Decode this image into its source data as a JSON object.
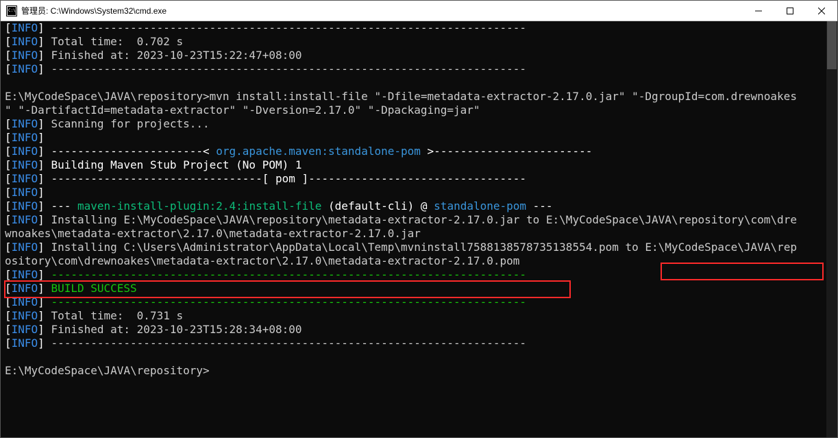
{
  "window": {
    "title": "管理员: C:\\Windows\\System32\\cmd.exe"
  },
  "colors": {
    "bg": "#0c0c0c",
    "fg": "#cccccc",
    "info": "#3b8eea",
    "green": "#16c60c",
    "cyan": "#3a96dd",
    "highlight": "#ff2a2a"
  },
  "l": {
    "dash1": " ------------------------------------------------------------------------",
    "total1": " Total time:  0.702 s",
    "fin1": " Finished at: 2023-10-23T15:22:47+08:00",
    "dash2": " ------------------------------------------------------------------------",
    "blank1": "",
    "prompt1a": "E:\\MyCodeSpace\\JAVA\\repository>",
    "cmd1": "mvn install:install-file \"-Dfile=metadata-extractor-2.17.0.jar\" \"-DgroupId=com.drewnoakes",
    "cmd2": "\" \"-DartifactId=metadata-extractor\" \"-Dversion=2.17.0\" \"-Dpackaging=jar\"",
    "scan": " Scanning for projects...",
    "blank2": "",
    "lt": " -----------------------< ",
    "pomlink": "org.apache.maven:standalone-pom",
    "gt": " >------------------------",
    "build": " Building Maven Stub Project (No POM) 1",
    "pommark": " --------------------------------[ pom ]---------------------------------",
    "blank3": "",
    "dashshort": " --- ",
    "plugin": "maven-install-plugin:2.4:install-file",
    "defcli": " (default-cli) @ ",
    "standalone": "standalone-pom",
    "dashend": " ---",
    "inst1a": " Installing E:\\MyCodeSpace\\JAVA\\repository\\metadata-extractor-2.17.0.jar to E:\\MyCodeSpace\\JAVA\\repository\\com\\dre",
    "inst1b": "wnoakes\\metadata-extractor\\2.17.0\\metadata-extractor-2.17.0.jar",
    "inst2a": " Installing C:\\Users\\Administrator\\AppData\\Local\\Temp\\mvninstall7588138578735138554.pom to E:\\MyCodeSpace\\JAVA\\rep",
    "inst2b": "ository\\com\\drewnoakes\\metadata-extractor\\2.17.0\\metadata-extractor-2.17.0.pom",
    "dash3": " ------------------------------------------------------------------------",
    "success": "BUILD SUCCESS",
    "dash4": " ------------------------------------------------------------------------",
    "total2": " Total time:  0.731 s",
    "fin2": " Finished at: 2023-10-23T15:28:34+08:00",
    "dash5": " ------------------------------------------------------------------------",
    "blank4": "",
    "prompt2": "E:\\MyCodeSpace\\JAVA\\repository>"
  }
}
